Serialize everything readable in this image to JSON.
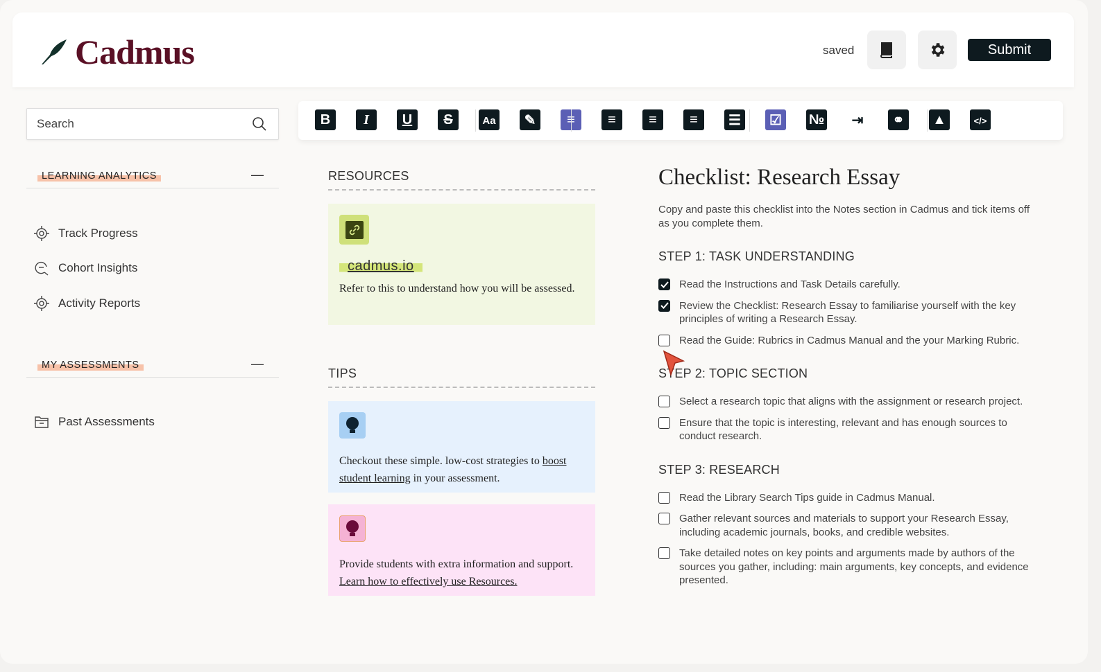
{
  "header": {
    "brand": "Cadmus",
    "status": "saved",
    "submit_label": "Submit"
  },
  "sidebar": {
    "search_placeholder": "Search",
    "sections": [
      {
        "title": "LEARNING ANALYTICS",
        "items": [
          "Track Progress",
          "Cohort Insights",
          "Activity Reports"
        ]
      },
      {
        "title": "MY ASSESSMENTS",
        "items": [
          "Past Assessments"
        ]
      }
    ]
  },
  "toolbar": {
    "buttons": [
      "bold",
      "italic",
      "underline",
      "strikethrough",
      "font-size",
      "edit",
      "align-left",
      "align-center",
      "align-right",
      "justify",
      "bullet-list",
      "checklist",
      "numbered-list",
      "indent",
      "link",
      "image",
      "code"
    ],
    "active": [
      "align-left",
      "checklist"
    ],
    "accent": "#5b5fb5"
  },
  "resources": {
    "title": "RESOURCES",
    "link": "cadmus.io",
    "text": "Refer to this to understand how you will be assessed."
  },
  "tips": {
    "title": "TIPS",
    "tip1": {
      "pre": "Checkout these simple. low-cost strategies to ",
      "link": "boost student learning",
      "post": " in your assessment."
    },
    "tip2": {
      "pre": "Provide students with extra information and support. ",
      "link": "Learn how to effectively use Resources."
    }
  },
  "doc": {
    "title": "Checklist: Research Essay",
    "intro": "Copy and paste this checklist into the Notes section in Cadmus and tick items off as you complete them.",
    "steps": [
      {
        "title": "STEP 1: TASK UNDERSTANDING",
        "items": [
          {
            "text": "Read the Instructions and Task Details carefully.",
            "checked": true
          },
          {
            "text": "Review the Checklist: Research Essay to familiarise yourself with the key principles of writing a Research Essay.",
            "checked": true
          },
          {
            "text": "Read the Guide: Rubrics in Cadmus Manual and the your Marking Rubric.",
            "checked": false
          }
        ]
      },
      {
        "title": "STEP 2: TOPIC SECTION",
        "items": [
          {
            "text": "Select a research topic that aligns with the assignment or research project.",
            "checked": false
          },
          {
            "text": "Ensure that the topic is interesting, relevant and has enough sources to conduct research.",
            "checked": false
          }
        ]
      },
      {
        "title": "STEP 3: RESEARCH",
        "items": [
          {
            "text": "Read the Library Search Tips guide in Cadmus Manual.",
            "checked": false
          },
          {
            "text": "Gather relevant sources and materials to support your Research Essay, including academic journals, books, and credible websites.",
            "checked": false
          },
          {
            "text": "Take detailed notes on key points and arguments made by authors of the sources you gather, including: main arguments, key concepts, and evidence presented.",
            "checked": false
          }
        ]
      }
    ]
  }
}
